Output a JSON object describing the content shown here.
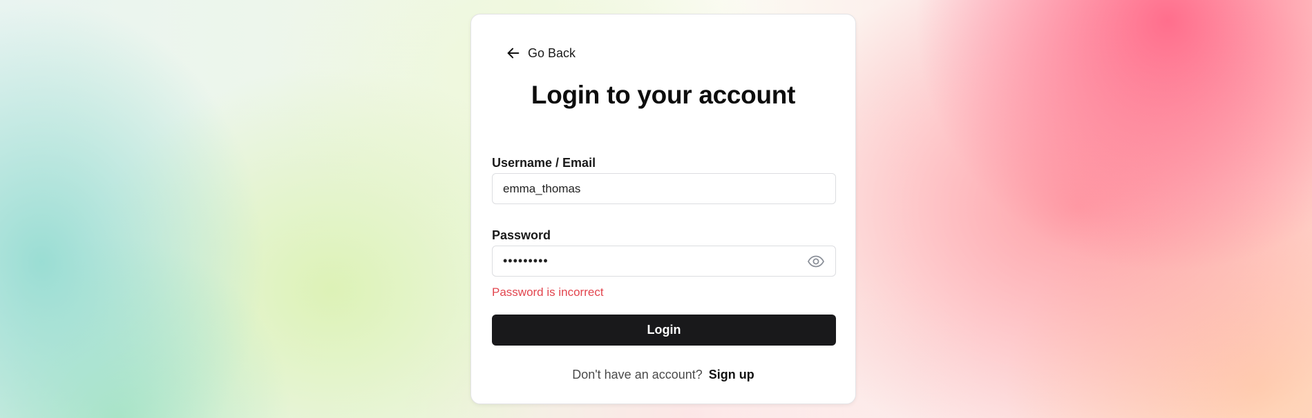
{
  "nav": {
    "back_label": "Go Back",
    "back_icon": "arrow-left-icon"
  },
  "title": "Login to your account",
  "form": {
    "username_label": "Username / Email",
    "username_value": "emma_thomas",
    "password_label": "Password",
    "password_value": "•••••••••",
    "password_toggle_icon": "eye-icon",
    "error_message": "Password is incorrect",
    "submit_label": "Login"
  },
  "footer": {
    "prompt": "Don't have an account?",
    "signup_label": "Sign up"
  },
  "colors": {
    "error": "#e2454e",
    "button_bg": "#19191b",
    "button_text": "#ffffff"
  }
}
